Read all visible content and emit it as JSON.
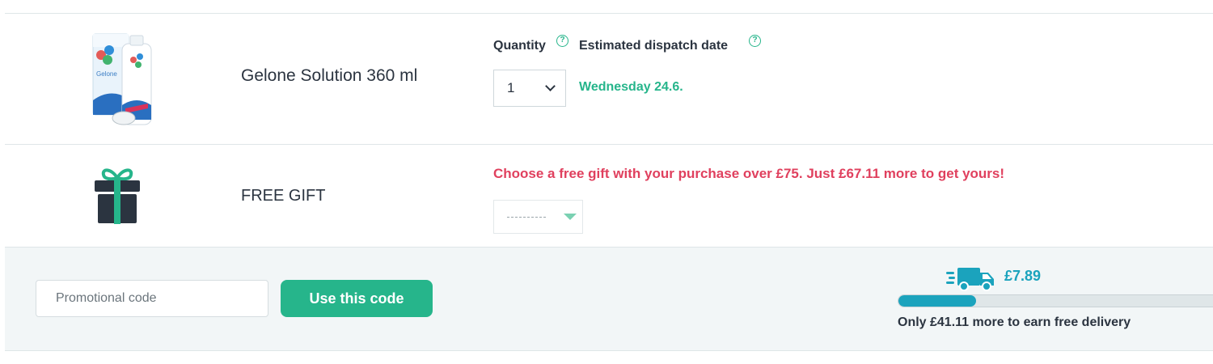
{
  "product": {
    "name": "Gelone Solution 360 ml",
    "brand_text": "Gelone",
    "quantity_label": "Quantity",
    "dispatch_label": "Estimated dispatch date",
    "help_glyph": "?",
    "quantity_value": "1",
    "dispatch_date": "Wednesday 24.6."
  },
  "gift": {
    "label": "FREE GIFT",
    "message": "Choose a free gift with your purchase over £75. Just £67.11 more to get yours!"
  },
  "promo": {
    "placeholder": "Promotional code",
    "button_label": "Use this code"
  },
  "delivery": {
    "price": "£7.89",
    "message": "Only £41.11 more to earn free delivery",
    "progress_percent": 24
  },
  "colors": {
    "accent_green": "#26b58b",
    "alert_red": "#e0405e",
    "delivery_blue": "#1ba3bd",
    "text_dark": "#2b3440"
  },
  "icons": [
    "help-icon",
    "chevron-down-icon",
    "gift-icon",
    "triangle-down-icon",
    "delivery-truck-icon"
  ]
}
